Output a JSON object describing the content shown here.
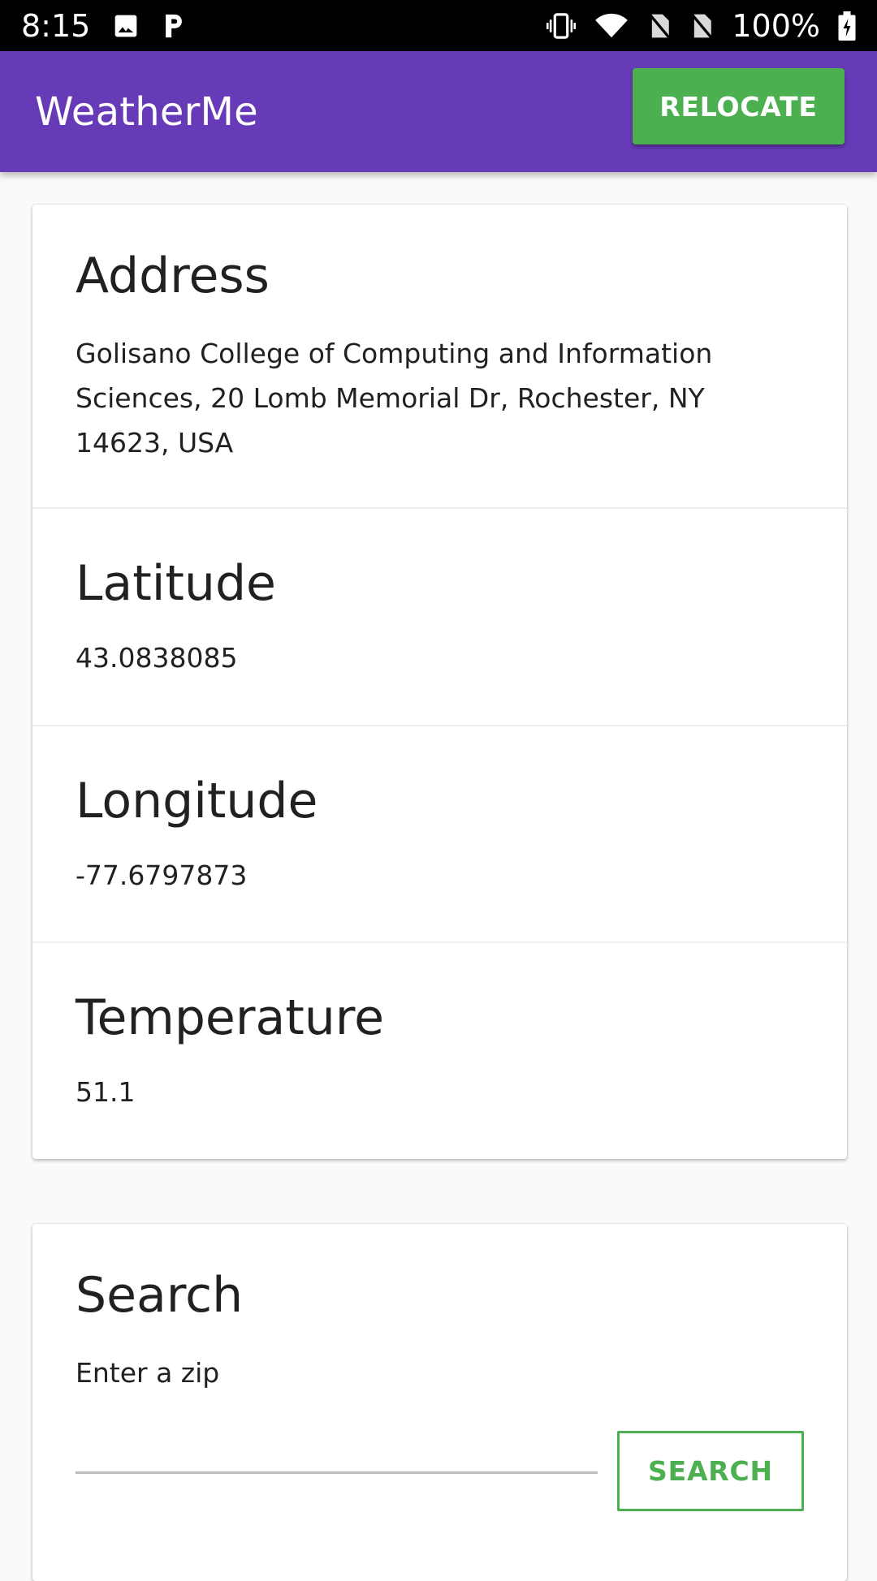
{
  "status_bar": {
    "time": "8:15",
    "battery": "100%",
    "icons": [
      "image-icon",
      "parking-icon",
      "vibrate-icon",
      "wifi-icon",
      "no-sim-icon",
      "no-sim-icon",
      "battery-charging-icon"
    ]
  },
  "app_bar": {
    "title": "WeatherMe",
    "relocate_label": "RELOCATE",
    "color": "#673ab7",
    "button_color": "#4caf50"
  },
  "info": {
    "address": {
      "title": "Address",
      "value": "Golisano College of Computing and Information Sciences, 20 Lomb Memorial Dr, Rochester, NY 14623, USA"
    },
    "latitude": {
      "title": "Latitude",
      "value": "43.0838085"
    },
    "longitude": {
      "title": "Longitude",
      "value": "-77.6797873"
    },
    "temperature": {
      "title": "Temperature",
      "value": "51.1"
    }
  },
  "search": {
    "title": "Search",
    "prompt": "Enter a zip",
    "input_value": "",
    "button_label": "SEARCH"
  }
}
